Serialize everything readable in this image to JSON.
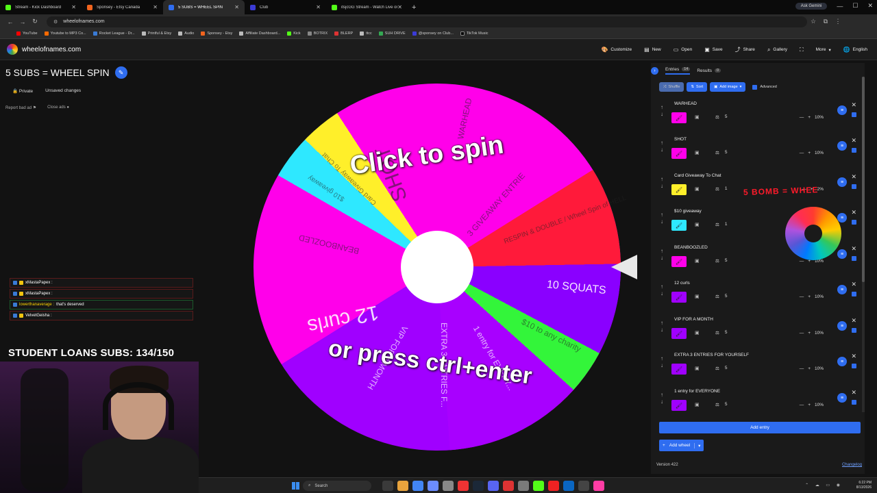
{
  "browser": {
    "tabs": [
      {
        "label": "Stream - Kick Dashboard",
        "color": "#53fc18"
      },
      {
        "label": "Sponsey - Etsy Canada",
        "color": "#f1641e"
      },
      {
        "label": "5 SUBS = WHEEL SPIN",
        "color": "#2f6df0",
        "active": true
      },
      {
        "label": "Club",
        "color": "#3b3bd6"
      },
      {
        "label": "itsjcGG Stream - Watch Live on",
        "color": "#53fc18"
      }
    ],
    "ask_gemini": "Ask Gemini",
    "url": "wheelofnames.com",
    "bookmarks": [
      "YouTube",
      "Youtube to MP3 Co...",
      "Rocket League - Dr...",
      "Printful & Etsy",
      "Audio",
      "Sponsey - Etsy",
      "Affiliate Dashboard...",
      "Kick",
      "BOTRIX",
      "BLERP",
      "ttcc",
      "SUH DRIVE",
      "@sponsey on Club...",
      "TikTok Music"
    ]
  },
  "site": {
    "name": "wheelofnames.com",
    "menu": [
      "Customize",
      "New",
      "Open",
      "Save",
      "Share",
      "Gallery",
      "More",
      "English"
    ],
    "menu_icons": [
      "palette-icon",
      "new-file-icon",
      "folder-icon",
      "save-icon",
      "share-icon",
      "gallery-icon",
      "fullscreen-icon",
      "more-icon",
      "globe-icon"
    ]
  },
  "wheel": {
    "title": "5 SUBS = WHEEL SPIN",
    "private": "Private",
    "unsaved": "Unsaved changes",
    "report_ad": "Report bad ad",
    "close_ads": "Close ads",
    "spin_line1": "Click to spin",
    "spin_line2": "or press ctrl+enter",
    "slice_labels": [
      "WARHEAD",
      "3 GIVEAWAY ENTRIE",
      "RESPIN & DOUBLE / Wheel Spin of HELL",
      "10 SQUATS",
      "$10 to any charity",
      "1 entry for EVERY...",
      "EXTRA 3 ENTRIES F...",
      "VIP FOR A MONTH",
      "12 curls",
      "BEANBOOZLED",
      "$10 giveaway",
      "Card Giveaway To Chat",
      "SHOT"
    ]
  },
  "panel": {
    "tab_entries": "Entries",
    "entries_count": "14",
    "tab_results": "Results",
    "results_count": "0",
    "shuffle": "Shuffle",
    "sort": "Sort",
    "add_image": "Add image",
    "advanced": "Advanced",
    "entries": [
      {
        "name": "WARHEAD",
        "weight": "5",
        "color": "#ff00ea",
        "pct": "10%"
      },
      {
        "name": "SHOT",
        "weight": "5",
        "color": "#ff00ea",
        "pct": "10%"
      },
      {
        "name": "Card Giveaway To Chat",
        "weight": "1",
        "color": "#ffef2a",
        "pct": "2%"
      },
      {
        "name": "$10 giveaway",
        "weight": "1",
        "color": "#2ee8ff",
        "pct": ""
      },
      {
        "name": "BEANBOOZLED",
        "weight": "5",
        "color": "#ff00ea",
        "pct": "10%"
      },
      {
        "name": "12 curls",
        "weight": "5",
        "color": "#a000ff",
        "pct": "10%"
      },
      {
        "name": "VIP FOR A MONTH",
        "weight": "5",
        "color": "#a000ff",
        "pct": "10%"
      },
      {
        "name": "EXTRA 3 ENTRIES FOR YOURSELF",
        "weight": "5",
        "color": "#a000ff",
        "pct": "10%"
      },
      {
        "name": "1 entry for EVERYONE",
        "weight": "5",
        "color": "#a000ff",
        "pct": "10%"
      }
    ],
    "add_entry": "Add entry",
    "add_wheel": "Add wheel",
    "version": "Version 422",
    "changelog": "Changelog"
  },
  "stream": {
    "overlay_text": "5 BOMB = WHEE",
    "loans_text": "STUDENT LOANS SUBS: 134/150",
    "chat": [
      {
        "user": "xMastaPapex :",
        "msg": "",
        "border": "red"
      },
      {
        "user": "xMastaPapex :",
        "msg": "",
        "border": "red"
      },
      {
        "user": "lowerthanaverage :",
        "msg": "that's deserved",
        "border": "green"
      },
      {
        "user": "VelvetGeisha :",
        "msg": "",
        "border": "red"
      }
    ]
  },
  "taskbar": {
    "search": "Search",
    "time": "6:22 PM",
    "date": "8/13/2026"
  }
}
